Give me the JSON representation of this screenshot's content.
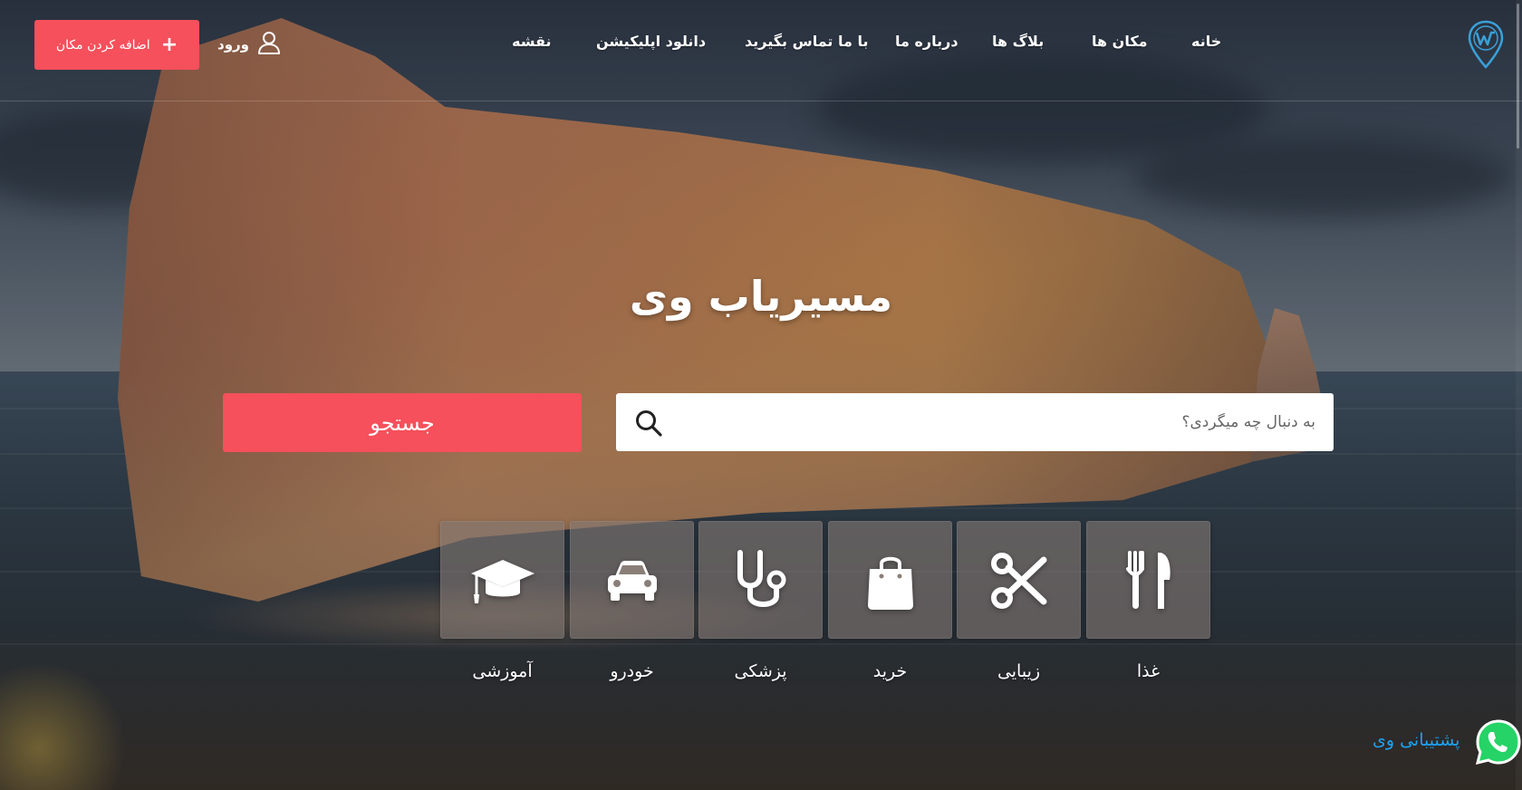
{
  "colors": {
    "accent": "#f5505b",
    "support_link": "#1da1f2",
    "logo": "#3ba0d8"
  },
  "header": {
    "logo_icon": "location-pin-w-logo",
    "nav": [
      {
        "label": "خانه"
      },
      {
        "label": "مکان ها"
      },
      {
        "label": "بلاگ ها"
      },
      {
        "label": "درباره ما"
      },
      {
        "label": "با ما تماس بگیرید"
      },
      {
        "label": "دانلود اپلیکیشن"
      },
      {
        "label": "نقشه"
      }
    ],
    "login_label": "ورود",
    "login_icon": "user-icon",
    "add_place_label": "اضافه کردن مکان",
    "add_place_icon": "plus-icon"
  },
  "hero": {
    "title": "مسیریاب وی",
    "search_placeholder": "به دنبال چه میگردی؟",
    "search_icon": "search-icon",
    "search_button": "جستجو"
  },
  "categories": [
    {
      "label": "غذا",
      "icon": "fork-knife-icon"
    },
    {
      "label": "زیبایی",
      "icon": "scissors-icon"
    },
    {
      "label": "خرید",
      "icon": "shopping-bag-icon"
    },
    {
      "label": "پزشکی",
      "icon": "stethoscope-icon"
    },
    {
      "label": "خودرو",
      "icon": "car-icon"
    },
    {
      "label": "آموزشی",
      "icon": "graduation-cap-icon"
    }
  ],
  "support": {
    "label": "پشتیبانی وی",
    "icon": "whatsapp-icon"
  }
}
